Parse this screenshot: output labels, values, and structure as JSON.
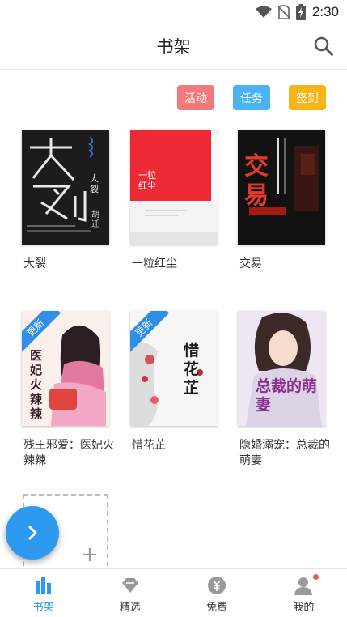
{
  "status_bar": {
    "time": "2:30",
    "icons": [
      "wifi-icon",
      "no-sim-icon",
      "battery-charging-icon"
    ]
  },
  "header": {
    "title": "书架",
    "search_icon": "search-icon"
  },
  "actions": {
    "activity": "活动",
    "task": "任务",
    "checkin": "签到"
  },
  "books": [
    {
      "title": "大裂",
      "cover_title": "大裂",
      "cover_author": "胡迁",
      "cover_big": "大裂",
      "updated": false
    },
    {
      "title": "一粒红尘",
      "cover_title": "一粒红尘",
      "cover_author": "",
      "updated": false
    },
    {
      "title": "交易",
      "cover_title": "交易",
      "updated": false
    },
    {
      "title": "残王邪爱：医妃火辣辣",
      "cover_title": "医妃火辣辣",
      "updated": true,
      "ribbon": "更新"
    },
    {
      "title": "惜花芷",
      "cover_title": "惜花芷",
      "updated": true,
      "ribbon": "更新"
    },
    {
      "title": "隐婚溺宠：总裁的萌妻",
      "cover_title": "总裁的萌妻",
      "updated": false
    }
  ],
  "add_slot": {
    "plus": "+"
  },
  "fab": {
    "icon": "chevron-right-icon"
  },
  "nav": [
    {
      "label": "书架",
      "icon": "bookshelf-icon",
      "active": true
    },
    {
      "label": "精选",
      "icon": "diamond-icon",
      "active": false
    },
    {
      "label": "免费",
      "icon": "yen-coin-icon",
      "active": false
    },
    {
      "label": "我的",
      "icon": "user-icon",
      "active": false,
      "badge": true
    }
  ],
  "colors": {
    "accent": "#2d9af0",
    "activity": "#f27a7a",
    "task": "#4ab3f4",
    "checkin": "#f8b417",
    "badge": "#f2534b"
  }
}
